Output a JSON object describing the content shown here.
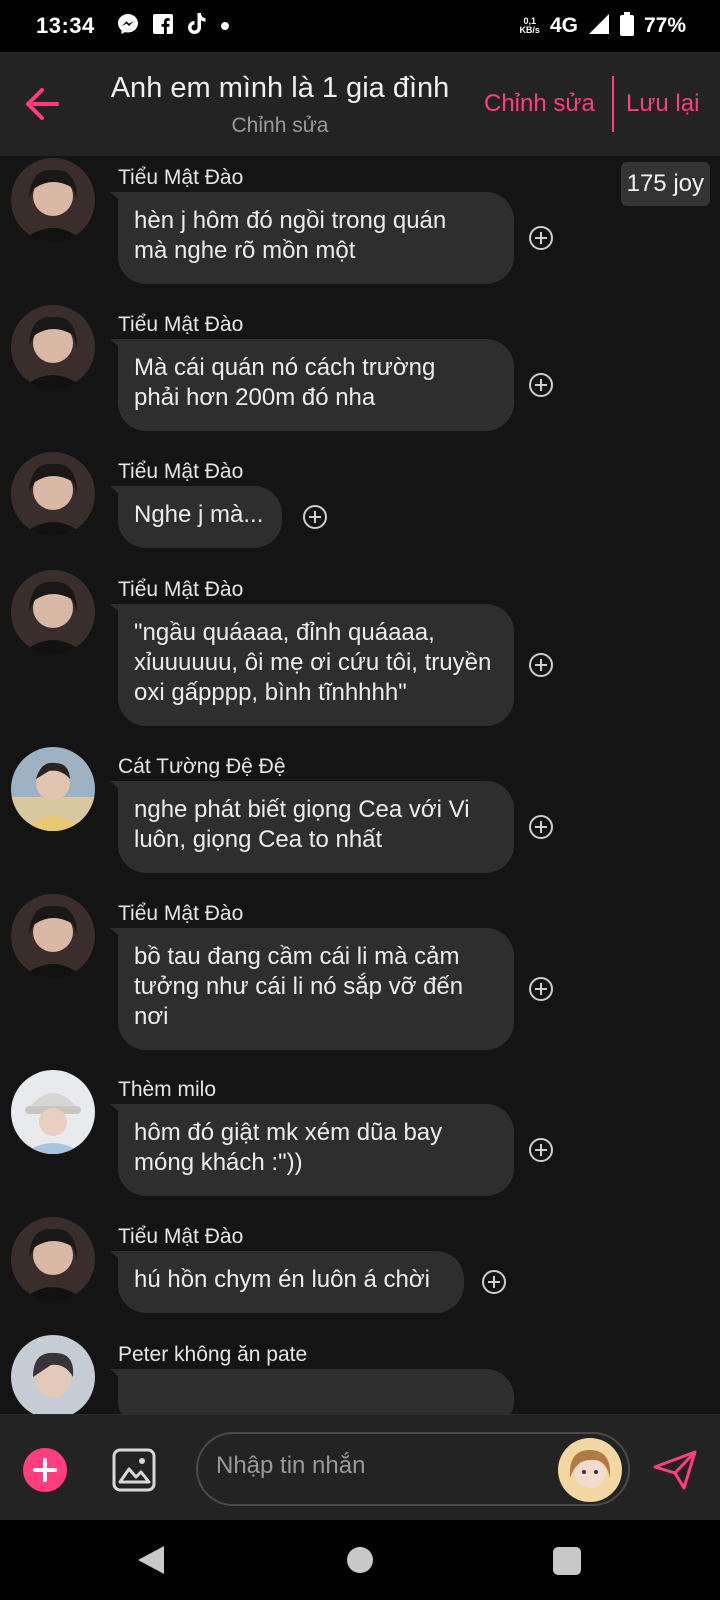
{
  "status_bar": {
    "time": "13:34",
    "speed_value": "0,1",
    "speed_unit": "KB/s",
    "network": "4G",
    "battery": "77%",
    "icons": [
      "messenger-icon",
      "facebook-icon",
      "tiktok-icon",
      "notification-dot-icon",
      "signal-icon",
      "battery-icon"
    ]
  },
  "header": {
    "title": "Anh em mình là 1 gia đình",
    "subtitle": "Chỉnh sửa",
    "edit_label": "Chỉnh sửa",
    "save_label": "Lưu lại",
    "accent_color": "#ff3d7f"
  },
  "joy_badge": "175 joy",
  "messages": [
    {
      "sender": "Tiểu Mật Đào",
      "lines": [
        "hèn j hôm đó ngồi trong quán",
        "mà nghe rõ mồn một"
      ]
    },
    {
      "sender": "Tiểu Mật Đào",
      "lines": [
        "Mà cái quán nó cách trường",
        "phải hơn 200m đó nha"
      ]
    },
    {
      "sender": "Tiểu Mật Đào",
      "lines": [
        "Nghe j mà..."
      ]
    },
    {
      "sender": "Tiểu Mật Đào",
      "lines": [
        "\"ngầu quáaaa, đỉnh quáaaa,",
        "xỉuuuuuu, ôi mẹ ơi cứu tôi, truyền",
        "oxi gấpppp, bình tĩnhhhh\""
      ]
    },
    {
      "sender": "Cát Tường Đệ Đệ",
      "lines": [
        "nghe phát biết giọng Cea với Vi",
        "luôn, giọng Cea to nhất"
      ]
    },
    {
      "sender": "Tiểu Mật Đào",
      "lines": [
        "bồ tau đang cầm cái li mà cảm",
        "tưởng như cái li nó sắp vỡ đến",
        "nơi"
      ]
    },
    {
      "sender": "Thèm milo",
      "lines": [
        "hôm đó giật mk xém dũa bay",
        "móng khách :\"))"
      ]
    },
    {
      "sender": "Tiểu Mật Đào",
      "lines": [
        "hú hồn chym én luôn á chời"
      ]
    },
    {
      "sender": "Peter không ăn pate",
      "lines": []
    }
  ],
  "composer": {
    "placeholder": "Nhập tin nhắn"
  }
}
